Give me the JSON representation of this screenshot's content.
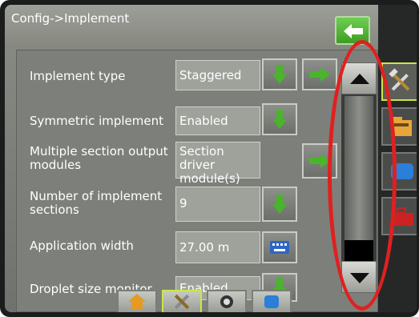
{
  "header": {
    "title": "Config->Implement"
  },
  "rows": [
    {
      "label": "Implement type",
      "value": "Staggered"
    },
    {
      "label": "Symmetric implement",
      "value": "Enabled"
    },
    {
      "label": "Multiple section output modules",
      "value": "Section driver module(s) found"
    },
    {
      "label": "Number of implement sections",
      "value": "9"
    },
    {
      "label": "Application width",
      "value": "27.00 m"
    },
    {
      "label": "Droplet size monitor",
      "value": "Enabled"
    }
  ],
  "colors": {
    "green_button": "#3f9d25",
    "active_outline": "#c9e64a",
    "annotation": "#e02020",
    "scroll_thumb": "#000000"
  },
  "icons": {
    "back": "back-arrow-icon",
    "dropdown": "down-arrow-icon",
    "next": "right-arrow-icon",
    "keyboard": "keyboard-icon",
    "home": "home-icon",
    "config": "tools-icon",
    "gauge": "gauge-icon",
    "guidance": "guidance-icon"
  }
}
